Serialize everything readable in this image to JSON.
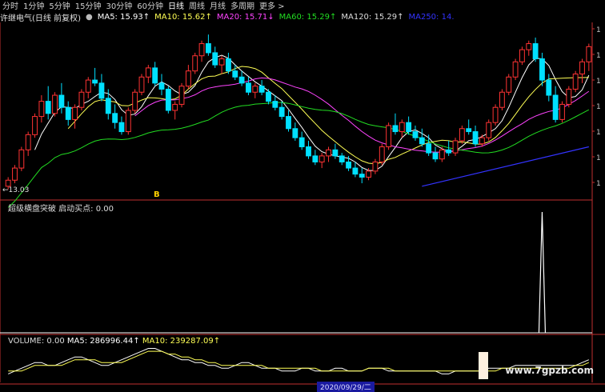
{
  "periods": [
    {
      "label": "分时",
      "active": false
    },
    {
      "label": "1分钟",
      "active": false
    },
    {
      "label": "5分钟",
      "active": false
    },
    {
      "label": "15分钟",
      "active": false
    },
    {
      "label": "30分钟",
      "active": false
    },
    {
      "label": "60分钟",
      "active": false
    },
    {
      "label": "日线",
      "active": true
    },
    {
      "label": "周线",
      "active": false
    },
    {
      "label": "月线",
      "active": false
    },
    {
      "label": "多周期",
      "active": false
    },
    {
      "label": "更多 >",
      "active": false
    }
  ],
  "stock": {
    "name": "许继电气(日线 前复权)"
  },
  "ma_items": [
    {
      "label": "MA5: 15.93↑",
      "color": "#ffffff"
    },
    {
      "label": "MA10: 15.62↑",
      "color": "#ffff55"
    },
    {
      "label": "MA20: 15.71↓",
      "color": "#ff44ff"
    },
    {
      "label": "MA60: 15.29↑",
      "color": "#22dd22"
    },
    {
      "label": "MA120: 15.29↑",
      "color": "#dddddd"
    },
    {
      "label": "MA250: 14.",
      "color": "#3333ff"
    }
  ],
  "price_axis_ticks": [
    "1",
    "1",
    "1",
    "1",
    "1",
    "1",
    "1"
  ],
  "low_label": "←13.03",
  "marker_glyph": "B",
  "indicator": {
    "label": "超级横盘突破  启动买点: 0.00"
  },
  "volume": {
    "label": "VOLUME: 0.00  ",
    "ma5": "MA5: 286996.44↑",
    "ma10": "MA10: 239287.09↑"
  },
  "date_badge": "2020/09/29/二",
  "watermark": "www.7gpzb.com",
  "colors": {
    "up": "#ff3333",
    "down": "#00e0ff",
    "ma5": "#ffffff",
    "ma10": "#ffff55",
    "ma20": "#ff44ff",
    "ma60": "#22dd22",
    "ma250": "#3333ff",
    "axis": "#c03030"
  },
  "chart_data": {
    "type": "candlestick",
    "candles": [
      [
        13.2,
        13.5,
        13.1,
        13.4
      ],
      [
        13.4,
        13.9,
        13.3,
        13.8
      ],
      [
        13.8,
        14.5,
        13.7,
        14.4
      ],
      [
        14.4,
        15.0,
        14.2,
        14.9
      ],
      [
        14.9,
        15.6,
        14.8,
        15.5
      ],
      [
        15.5,
        16.2,
        15.3,
        16.0
      ],
      [
        16.0,
        16.5,
        15.4,
        15.6
      ],
      [
        15.6,
        16.3,
        15.5,
        16.2
      ],
      [
        16.2,
        16.6,
        15.6,
        15.8
      ],
      [
        15.8,
        16.0,
        15.2,
        15.4
      ],
      [
        15.4,
        15.9,
        15.1,
        15.8
      ],
      [
        15.8,
        16.4,
        15.7,
        16.3
      ],
      [
        16.3,
        16.8,
        16.1,
        16.7
      ],
      [
        16.7,
        17.1,
        16.5,
        16.6
      ],
      [
        16.6,
        16.9,
        16.0,
        16.1
      ],
      [
        16.1,
        16.4,
        15.4,
        15.6
      ],
      [
        15.6,
        15.9,
        15.1,
        15.3
      ],
      [
        15.3,
        15.5,
        14.9,
        15.0
      ],
      [
        15.0,
        15.8,
        14.9,
        15.7
      ],
      [
        15.7,
        16.4,
        15.6,
        16.3
      ],
      [
        16.3,
        16.9,
        16.2,
        16.8
      ],
      [
        16.8,
        17.2,
        16.6,
        17.1
      ],
      [
        17.1,
        17.3,
        16.5,
        16.6
      ],
      [
        16.6,
        16.9,
        16.2,
        16.4
      ],
      [
        16.4,
        16.5,
        15.6,
        15.7
      ],
      [
        15.7,
        16.0,
        15.4,
        15.9
      ],
      [
        15.9,
        16.6,
        15.8,
        16.5
      ],
      [
        16.5,
        17.2,
        16.4,
        17.0
      ],
      [
        17.0,
        17.6,
        16.9,
        17.5
      ],
      [
        17.5,
        18.0,
        17.3,
        17.9
      ],
      [
        17.9,
        18.2,
        17.5,
        17.6
      ],
      [
        17.6,
        17.8,
        17.1,
        17.2
      ],
      [
        17.2,
        17.5,
        16.9,
        17.4
      ],
      [
        17.4,
        17.6,
        16.9,
        17.0
      ],
      [
        17.0,
        17.2,
        16.7,
        16.8
      ],
      [
        16.8,
        17.0,
        16.5,
        16.6
      ],
      [
        16.6,
        16.8,
        16.2,
        16.3
      ],
      [
        16.3,
        16.6,
        16.1,
        16.5
      ],
      [
        16.5,
        16.7,
        16.2,
        16.3
      ],
      [
        16.3,
        16.4,
        15.9,
        16.0
      ],
      [
        16.0,
        16.2,
        15.7,
        15.8
      ],
      [
        15.8,
        16.0,
        15.4,
        15.5
      ],
      [
        15.5,
        15.7,
        15.0,
        15.1
      ],
      [
        15.1,
        15.3,
        14.7,
        14.8
      ],
      [
        14.8,
        15.0,
        14.4,
        14.5
      ],
      [
        14.5,
        14.7,
        14.1,
        14.2
      ],
      [
        14.2,
        14.4,
        13.9,
        14.0
      ],
      [
        14.0,
        14.3,
        13.8,
        14.2
      ],
      [
        14.2,
        14.5,
        14.0,
        14.4
      ],
      [
        14.4,
        14.6,
        14.1,
        14.2
      ],
      [
        14.2,
        14.3,
        13.9,
        14.0
      ],
      [
        14.0,
        14.2,
        13.7,
        13.8
      ],
      [
        13.8,
        14.0,
        13.5,
        13.6
      ],
      [
        13.6,
        13.8,
        13.3,
        13.5
      ],
      [
        13.5,
        13.8,
        13.4,
        13.7
      ],
      [
        13.7,
        14.1,
        13.6,
        14.0
      ],
      [
        14.0,
        14.6,
        13.9,
        14.5
      ],
      [
        14.5,
        15.3,
        14.4,
        15.2
      ],
      [
        15.2,
        15.6,
        14.9,
        15.0
      ],
      [
        15.0,
        15.4,
        14.8,
        15.3
      ],
      [
        15.3,
        15.5,
        14.9,
        15.0
      ],
      [
        15.0,
        15.2,
        14.7,
        14.8
      ],
      [
        14.8,
        15.1,
        14.5,
        14.6
      ],
      [
        14.6,
        14.9,
        14.2,
        14.3
      ],
      [
        14.3,
        14.5,
        14.0,
        14.1
      ],
      [
        14.1,
        14.5,
        14.0,
        14.4
      ],
      [
        14.4,
        14.7,
        14.2,
        14.3
      ],
      [
        14.3,
        14.8,
        14.2,
        14.7
      ],
      [
        14.7,
        15.2,
        14.6,
        15.1
      ],
      [
        15.1,
        15.4,
        14.9,
        15.0
      ],
      [
        15.0,
        15.2,
        14.5,
        14.6
      ],
      [
        14.6,
        14.9,
        14.5,
        14.8
      ],
      [
        14.8,
        15.4,
        14.7,
        15.3
      ],
      [
        15.3,
        15.9,
        15.2,
        15.8
      ],
      [
        15.8,
        16.4,
        15.7,
        16.3
      ],
      [
        16.3,
        16.9,
        16.2,
        16.8
      ],
      [
        16.8,
        17.4,
        16.7,
        17.3
      ],
      [
        17.3,
        17.8,
        17.2,
        17.7
      ],
      [
        17.7,
        18.0,
        17.5,
        17.9
      ],
      [
        17.9,
        18.1,
        17.3,
        17.4
      ],
      [
        17.4,
        17.6,
        16.5,
        16.7
      ],
      [
        16.7,
        16.9,
        16.0,
        16.2
      ],
      [
        16.2,
        16.5,
        15.3,
        15.4
      ],
      [
        15.4,
        16.0,
        15.3,
        15.9
      ],
      [
        15.9,
        16.5,
        15.8,
        16.4
      ],
      [
        16.4,
        17.0,
        16.3,
        16.9
      ],
      [
        16.9,
        17.4,
        16.6,
        17.3
      ],
      [
        17.3,
        17.9,
        17.0,
        17.8
      ]
    ],
    "ma_series": [
      {
        "name": "MA5",
        "color": "#ffffff"
      },
      {
        "name": "MA10",
        "color": "#ffff55"
      },
      {
        "name": "MA20",
        "color": "#ff44ff"
      },
      {
        "name": "MA60",
        "color": "#22dd22"
      },
      {
        "name": "MA250",
        "color": "#3333ff"
      }
    ],
    "ma250": [
      [
        62,
        13.2
      ],
      [
        87,
        14.5
      ]
    ],
    "ylim": [
      12.8,
      18.6
    ],
    "indicator_values": {
      "spike_index": 80,
      "value": 1,
      "baseline": 0
    },
    "volume_ma5": [
      3,
      4,
      5,
      6,
      7,
      7,
      6,
      6,
      7,
      8,
      9,
      9,
      8,
      7,
      6,
      6,
      7,
      8,
      9,
      10,
      11,
      12,
      12,
      11,
      10,
      9,
      8,
      8,
      7,
      7,
      6,
      6,
      5,
      5,
      6,
      7,
      7,
      6,
      5,
      5,
      5,
      4,
      4,
      4,
      5,
      5,
      4,
      4,
      4,
      5,
      5,
      4,
      4,
      4,
      5,
      5,
      5,
      4,
      4,
      4,
      4,
      4,
      4,
      4,
      4,
      3,
      3,
      4,
      4,
      4,
      4,
      4,
      5,
      5,
      5,
      5,
      6,
      6,
      6,
      6,
      6,
      6,
      6,
      6,
      6,
      6,
      7,
      8
    ],
    "volume_ma10": [
      4,
      4,
      4,
      5,
      6,
      6,
      6,
      6,
      6,
      7,
      8,
      8,
      8,
      8,
      7,
      7,
      7,
      7,
      8,
      9,
      10,
      11,
      11,
      11,
      10,
      10,
      9,
      9,
      8,
      8,
      7,
      7,
      6,
      6,
      6,
      6,
      6,
      6,
      6,
      5,
      5,
      5,
      5,
      5,
      5,
      5,
      5,
      4,
      4,
      4,
      4,
      4,
      4,
      4,
      5,
      5,
      5,
      5,
      4,
      4,
      4,
      4,
      4,
      4,
      4,
      4,
      4,
      4,
      4,
      4,
      4,
      4,
      4,
      4,
      5,
      5,
      5,
      5,
      5,
      5,
      5,
      5,
      5,
      5,
      5,
      6,
      6,
      7
    ]
  }
}
